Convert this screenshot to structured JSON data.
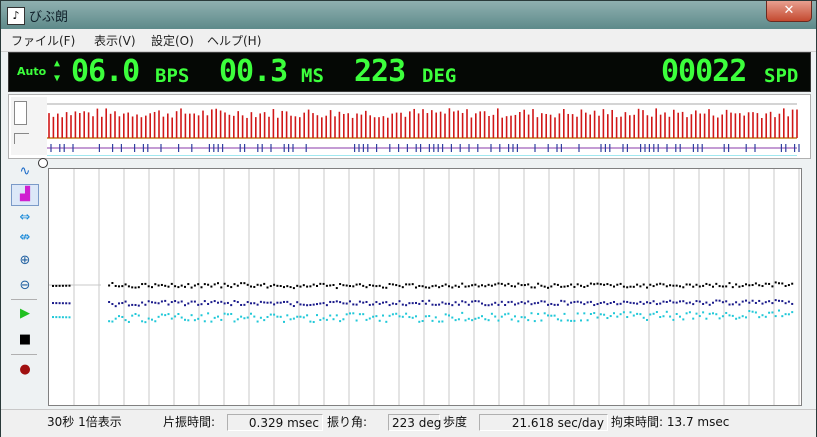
{
  "window": {
    "title": "びぶ朗",
    "close_label": "✕"
  },
  "menu": [
    {
      "label": "ファイル(F)"
    },
    {
      "label": "表示(V)"
    },
    {
      "label": "設定(O)"
    },
    {
      "label": "ヘルプ(H)"
    }
  ],
  "display": {
    "mode": "Auto",
    "bps_value": "06.0",
    "bps_unit": "BPS",
    "ms_value": "00.3",
    "ms_unit": "MS",
    "deg_value": "223",
    "deg_unit": "DEG",
    "spd_value": "00022",
    "spd_unit": "SPD"
  },
  "toolbar": {
    "tools": [
      {
        "name": "waveform-tool",
        "icon": "wave-icon",
        "glyph": "∿",
        "color": "#1a6ac8",
        "active": false
      },
      {
        "name": "histogram-tool",
        "icon": "histogram-icon",
        "glyph": "▟",
        "color": "#d020d0",
        "active": true
      },
      {
        "name": "expand-horizontal-tool",
        "icon": "expand-arrows-icon",
        "glyph": "⇔",
        "color": "#1a8ad8",
        "active": false
      },
      {
        "name": "shrink-horizontal-tool",
        "icon": "shrink-arrows-icon",
        "glyph": "⇎",
        "color": "#1a8ad8",
        "active": false
      },
      {
        "name": "zoom-in-tool",
        "icon": "magnifier-plus-icon",
        "glyph": "🔍︎",
        "color": "#2060a0",
        "active": false
      },
      {
        "name": "zoom-out-tool",
        "icon": "magnifier-minus-icon",
        "glyph": "🔍︎",
        "color": "#2060a0",
        "active": false
      },
      {
        "name": "play-button",
        "icon": "play-icon",
        "glyph": "▶",
        "color": "#20c020",
        "active": false
      },
      {
        "name": "stop-button",
        "icon": "stop-icon",
        "glyph": "■",
        "color": "#000000",
        "active": false
      },
      {
        "name": "record-button",
        "icon": "record-icon",
        "glyph": "●",
        "color": "#a01010",
        "active": false
      }
    ]
  },
  "status": {
    "view": "30秒 1倍表示",
    "amplitude_time_label": "片振時間:",
    "amplitude_time_value": "0.329 msec",
    "swing_angle_label": "振り角:",
    "swing_angle_value": "223 deg",
    "rate_label": "歩度",
    "rate_value": "21.618 sec/day",
    "lock_time": "拘束時間: 13.7 msec"
  },
  "chart_data": {
    "type": "scatter",
    "title": "",
    "xlabel": "",
    "ylabel": "",
    "grid": "vertical",
    "series": [
      {
        "color": "#000000",
        "trend": [
          283,
          282,
          283,
          282,
          283,
          283,
          283,
          282,
          283,
          282,
          283,
          282,
          281
        ]
      },
      {
        "color": "#1a1a8a",
        "trend": [
          300,
          301,
          300,
          300,
          301,
          300,
          300,
          300,
          300,
          300,
          299,
          300,
          299
        ]
      },
      {
        "color": "#20c8d8",
        "trend": [
          314,
          315,
          315,
          314,
          315,
          314,
          315,
          314,
          314,
          313,
          313,
          312,
          312
        ]
      }
    ]
  }
}
